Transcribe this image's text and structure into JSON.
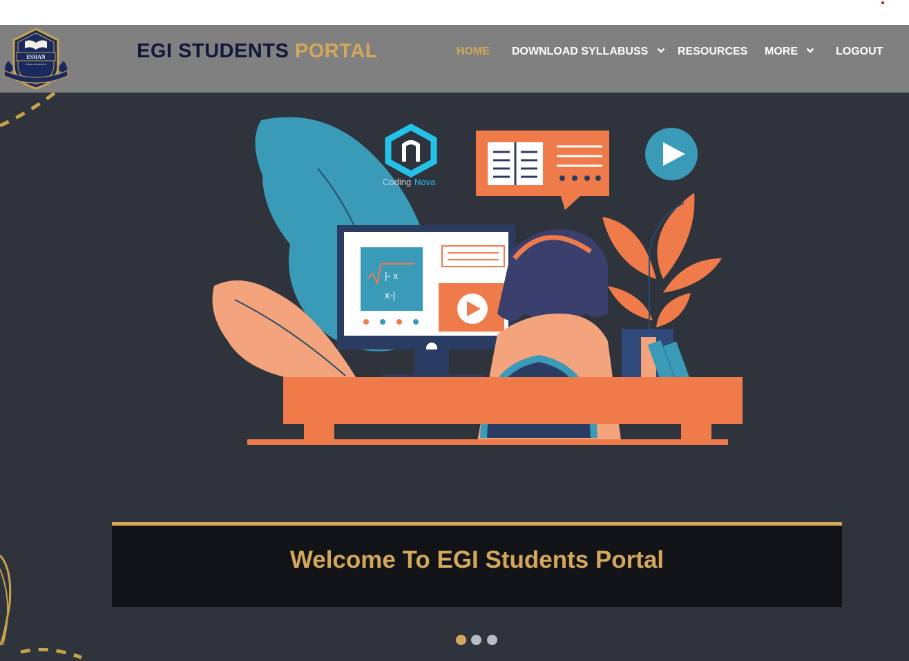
{
  "topbar": {
    "indicator_color": "#d0021b"
  },
  "header": {
    "logo_name": "ESHAN",
    "logo_subtitle": "College of Engineering",
    "brand_part1": "EGI STUDENTS",
    "brand_part2": "PORTAL",
    "nav": [
      {
        "label": "HOME",
        "active": true
      },
      {
        "label": "DOWNLOAD SYLLABUSS",
        "has_dropdown": true
      },
      {
        "label": "RESOURCES"
      },
      {
        "label": "MORE",
        "has_dropdown": true
      },
      {
        "label": "LOGOUT"
      }
    ]
  },
  "hero": {
    "illustration": {
      "logo_text_1": "Coding",
      "logo_text_2": "Nova",
      "board_line_1": "|- x",
      "board_line_2": "x-|"
    },
    "welcome_text": "Welcome To EGI Students Portal",
    "slides": 3,
    "active_slide": 1
  },
  "colors": {
    "accent": "#d4a85a",
    "nav_bg": "#808080",
    "hero_bg": "#2f333c",
    "brand_dark": "#14163a"
  }
}
